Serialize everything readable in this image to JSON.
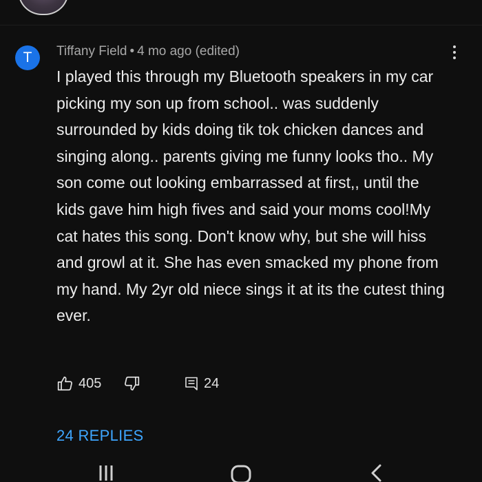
{
  "comment": {
    "avatar_letter": "T",
    "author": "Tiffany Field",
    "separator": "•",
    "time": "4 mo ago (edited)",
    "text": "I played this through my Bluetooth speakers in my car picking my son up from school..  was suddenly surrounded by kids doing tik tok chicken dances and singing along.. parents giving me funny looks tho.. My son come out looking embarrassed at first,, until the kids gave him high fives and said your moms cool!My cat hates this song. Don't know why, but she will hiss and growl at it. She has even smacked my phone from my hand. My 2yr old niece sings it at its the cutest thing ever.",
    "likes": "405",
    "reply_count": "24",
    "replies_label": "24 REPLIES",
    "more_icon": "more-vertical-icon",
    "like_icon": "thumbs-up-icon",
    "dislike_icon": "thumbs-down-icon",
    "reply_icon": "comment-icon"
  },
  "navbar": {
    "icons": [
      "recent-apps-icon",
      "home-icon",
      "back-icon"
    ]
  },
  "colors": {
    "background": "#0f0f0f",
    "avatar": "#1a73e8",
    "replies_link": "#3ea6ff"
  }
}
